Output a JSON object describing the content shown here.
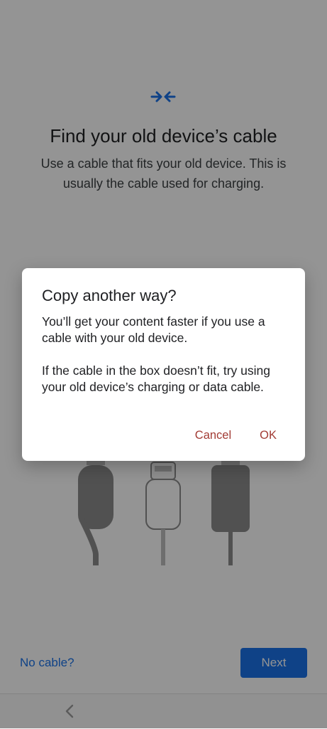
{
  "status_bar": {
    "icons": [
      "nfc-icon",
      "wifi-icon",
      "battery-icon"
    ]
  },
  "page": {
    "icon": "arrows-inward-icon",
    "title": "Find your old device’s cable",
    "subtitle": "Use a cable that fits your old device. This is usually the cable used for charging.",
    "illustration": "cable-types-illustration"
  },
  "footer": {
    "no_cable_label": "No cable?",
    "next_label": "Next"
  },
  "nav_bar": {
    "back_icon": "back-chevron-icon"
  },
  "dialog": {
    "title": "Copy another way?",
    "paragraph1": "You’ll get your content faster if you use a cable with your old device.",
    "paragraph2": "If the cable in the box doesn’t fit, try using your old device’s charging or data cable.",
    "cancel_label": "Cancel",
    "ok_label": "OK"
  },
  "colors": {
    "accent": "#1a73e8",
    "dialog_button": "#a23b34",
    "scrim": "rgba(0,0,0,0.42)"
  }
}
